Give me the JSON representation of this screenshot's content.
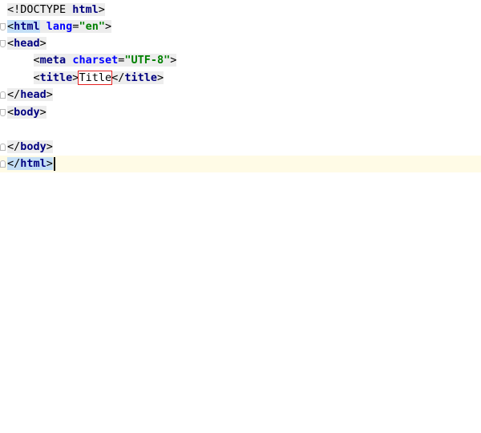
{
  "editor": {
    "lines": [
      {
        "doctype": "<!DOCTYPE ",
        "doctype_kw": "html",
        "doctype_end": ">"
      },
      {
        "open": "<",
        "tag": "html",
        "space": " ",
        "attr": "lang",
        "eq": "=",
        "val": "\"en\"",
        "close": ">"
      },
      {
        "open": "<",
        "tag": "head",
        "close": ">"
      },
      {
        "indent": "    ",
        "open": "<",
        "tag": "meta",
        "space": " ",
        "attr": "charset",
        "eq": "=",
        "val": "\"UTF-8\"",
        "close": ">"
      },
      {
        "indent": "    ",
        "open": "<",
        "tag": "title",
        "close": ">",
        "text": "Title",
        "end_open": "</",
        "end_tag": "title",
        "end_close": ">"
      },
      {
        "open": "</",
        "tag": "head",
        "close": ">"
      },
      {
        "open": "<",
        "tag": "body",
        "close": ">"
      },
      {},
      {
        "open": "</",
        "tag": "body",
        "close": ">"
      },
      {
        "open": "</",
        "tag": "html",
        "close": ">"
      }
    ]
  }
}
